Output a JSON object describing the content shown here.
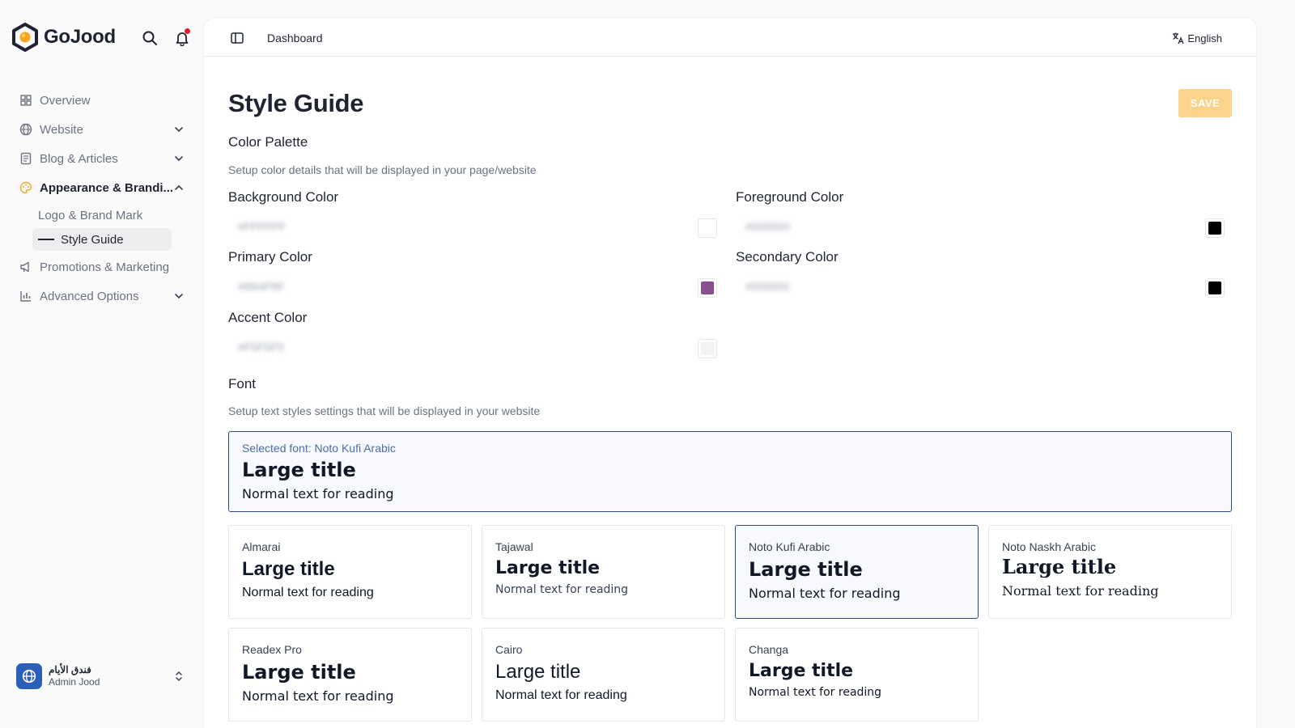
{
  "brand": {
    "name": "GoJood"
  },
  "nav": {
    "overview": "Overview",
    "website": "Website",
    "blog": "Blog & Articles",
    "appearance": "Appearance & Brandi...",
    "logo": "Logo & Brand Mark",
    "style_guide": "Style Guide",
    "promotions": "Promotions & Marketing",
    "advanced": "Advanced Options"
  },
  "account": {
    "name": "فندق الأيام",
    "role": "Admin Jood"
  },
  "topbar": {
    "title": "Dashboard",
    "language": "English"
  },
  "page": {
    "title": "Style Guide",
    "save_label": "SAVE",
    "palette_title": "Color Palette",
    "palette_desc": "Setup color details that will be displayed in your page/website",
    "font_title": "Font",
    "font_desc": "Setup text styles settings that will be displayed in your website"
  },
  "colors": {
    "background": {
      "label": "Background Color",
      "value": "#FFFFFF",
      "swatch": "#ffffff"
    },
    "foreground": {
      "label": "Foreground Color",
      "value": "#000000",
      "swatch": "#000000"
    },
    "primary": {
      "label": "Primary Color",
      "value": "#8B4F8F",
      "swatch": "#8b4f8f"
    },
    "secondary": {
      "label": "Secondary Color",
      "value": "#000000",
      "swatch": "#000000"
    },
    "accent": {
      "label": "Accent Color",
      "value": "#F5F5F5",
      "swatch": "#f3f3f3"
    }
  },
  "selected_font": {
    "label": "Selected font: Noto Kufi Arabic",
    "large": "Large title",
    "normal": "Normal text for reading"
  },
  "fonts": [
    {
      "name": "Almarai",
      "large": "Large title",
      "normal": "Normal text for reading"
    },
    {
      "name": "Tajawal",
      "large": "Large title",
      "normal": "Normal text for reading"
    },
    {
      "name": "Noto Kufi Arabic",
      "large": "Large title",
      "normal": "Normal text for reading"
    },
    {
      "name": "Noto Naskh Arabic",
      "large": "Large title",
      "normal": "Normal text for reading"
    },
    {
      "name": "Readex Pro",
      "large": "Large title",
      "normal": "Normal text for reading"
    },
    {
      "name": "Cairo",
      "large": "Large title",
      "normal": "Normal text for reading"
    },
    {
      "name": "Changa",
      "large": "Large title",
      "normal": "Normal text for reading"
    }
  ],
  "theme": {
    "accent": "#fcd38b",
    "selected_border": "#2b4a80",
    "brand_blue": "#2b5fb8"
  }
}
